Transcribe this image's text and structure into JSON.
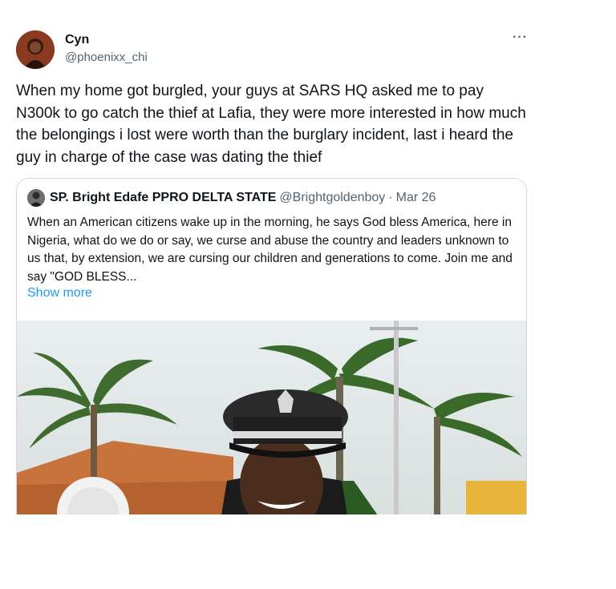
{
  "tweet": {
    "display_name": "Cyn",
    "handle": "@phoenixx_chi",
    "more_icon": "more-horizontal-icon",
    "text": "When my home got burgled, your guys at SARS HQ asked me to pay N300k to go catch the thief at Lafia, they were more interested in how much the belongings i lost were worth than the burglary incident, last i heard the guy in charge of the case was dating the thief"
  },
  "quote": {
    "display_name": "SP. Bright Edafe PPRO DELTA STATE",
    "handle": "@Brightgoldenboy",
    "separator": "·",
    "date": "Mar 26",
    "text": "When an American citizens wake up in the morning, he says God bless America, here in Nigeria, what do we do or say, we curse and abuse the country and leaders unknown to us that, by extension, we are cursing our children and generations to come. Join me and say \"GOD BLESS...",
    "show_more": "Show more"
  }
}
